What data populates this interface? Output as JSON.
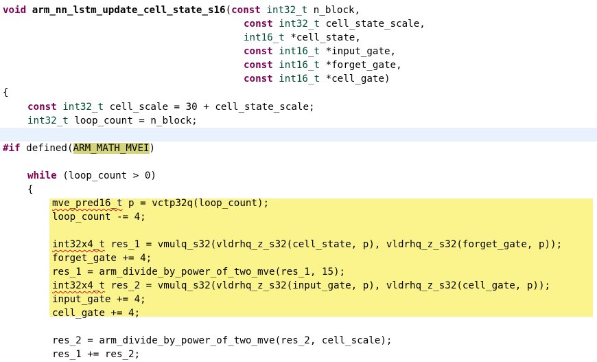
{
  "editor": {
    "code": {
      "sig_void": "void",
      "sig_fname": "arm_nn_lstm_update_cell_state_s16",
      "sig_paren": "(",
      "const": "const",
      "int32_t": "int32_t",
      "int16_t": "int16_t",
      "p1_name": " n_block,",
      "p2_name": " cell_state_scale,",
      "p3_name": " *cell_state,",
      "p4_name": " *input_gate,",
      "p5_name": " *forget_gate,",
      "p6_name": " *cell_gate)",
      "brace_open": "{",
      "l1_rest": " cell_scale = 30 + cell_state_scale;",
      "l2_rest": " loop_count = n_block;",
      "pp_if": "#if",
      "pp_defined": " defined(",
      "pp_macro": "ARM_MATH_MVEI",
      "pp_close": ")",
      "while_kw": "while",
      "while_rest": " (loop_count > 0)",
      "brace_inner": "{",
      "b1_type": "mve_pred16_t",
      "b1_rest": " p = vctp32q(loop_count);",
      "b2": "loop_count -= 4;",
      "b3_type": "int32x4_t",
      "b3_rest": " res_1 = vmulq_s32(vldrhq_z_s32(cell_state, p), vldrhq_z_s32(forget_gate, p));",
      "b4": "forget_gate += 4;",
      "b5": "res_1 = arm_divide_by_power_of_two_mve(res_1, 15);",
      "b6_type": "int32x4_t",
      "b6_rest": " res_2 = vmulq_s32(vldrhq_z_s32(input_gate, p), vldrhq_z_s32(cell_gate, p));",
      "b7": "input_gate += 4;",
      "b8": "cell_gate += 4;",
      "a1": "res_2 = arm_divide_by_power_of_two_mve(res_2, cell_scale);",
      "a2": "res_1 += res_2;"
    }
  },
  "colors": {
    "keyword": "#7f0055",
    "type": "#005032",
    "current_line": "#e8f2fe",
    "inactive_code": "#fbf48c",
    "occurrence": "#d4d47c"
  }
}
